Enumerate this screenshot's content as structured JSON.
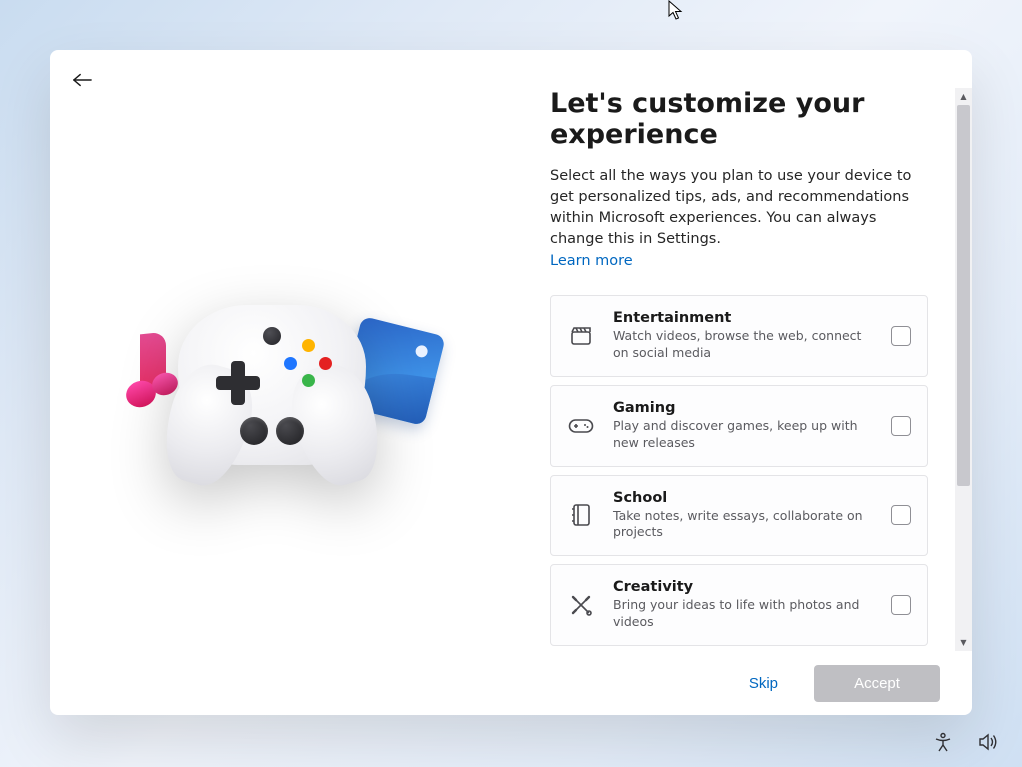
{
  "page": {
    "title": "Let's customize your experience",
    "description": "Select all the ways you plan to use your device to get personalized tips, ads, and recommendations within Microsoft experiences. You can always change this in Settings.",
    "learn_more": "Learn more",
    "skip_label": "Skip",
    "accept_label": "Accept"
  },
  "options": [
    {
      "id": "entertainment",
      "icon": "film-clapper-icon",
      "title": "Entertainment",
      "description": "Watch videos, browse the web, connect on social media"
    },
    {
      "id": "gaming",
      "icon": "gamepad-icon",
      "title": "Gaming",
      "description": "Play and discover games, keep up with new releases"
    },
    {
      "id": "school",
      "icon": "notebook-icon",
      "title": "School",
      "description": "Take notes, write essays, collaborate on projects"
    },
    {
      "id": "creativity",
      "icon": "pen-brush-icon",
      "title": "Creativity",
      "description": "Bring your ideas to life with photos and videos"
    }
  ]
}
